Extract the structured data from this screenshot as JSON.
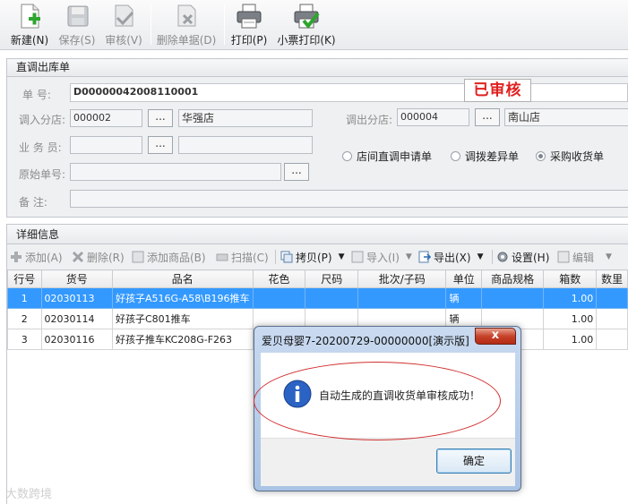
{
  "toolbar": {
    "buttons": [
      {
        "label": "新建(N)",
        "icon": "new-document-icon"
      },
      {
        "label": "保存(S)",
        "icon": "save-disk-icon"
      },
      {
        "label": "审核(V)",
        "icon": "approve-check-icon"
      },
      {
        "label": "删除单据(D)",
        "icon": "delete-document-icon"
      },
      {
        "label": "打印(P)",
        "icon": "printer-icon"
      },
      {
        "label": "小票打印(K)",
        "icon": "receipt-printer-icon"
      }
    ]
  },
  "form": {
    "panel_title": "直调出库单",
    "order_no_label": "单    号:",
    "order_no": "D00000042008110001",
    "status": "已审核",
    "in_store_label": "调入分店:",
    "in_store_code": "000002",
    "in_store_name": "华强店",
    "out_store_label": "调出分店:",
    "out_store_code": "000004",
    "out_store_name": "南山店",
    "clerk_label": "业 务 员:",
    "clerk_code": "",
    "clerk_name": "",
    "origin_label": "原始单号:",
    "origin_value": "",
    "note_label": "备    注:",
    "note_value": "",
    "ellipsis": "...",
    "radios": [
      {
        "label": "店间直调申请单",
        "checked": false
      },
      {
        "label": "调拨差异单",
        "checked": false
      },
      {
        "label": "采购收货单",
        "checked": true
      }
    ]
  },
  "detail": {
    "panel_title": "详细信息",
    "tools": [
      "添加(A)",
      "删除(R)",
      "添加商品(B)",
      "扫描(C)",
      "拷贝(P)",
      "导入(I)",
      "导出(X)",
      "设置(H)",
      "编辑"
    ],
    "columns": [
      "行号",
      "货号",
      "品名",
      "花色",
      "尺码",
      "批次/子码",
      "单位",
      "商品规格",
      "箱数",
      "数里"
    ],
    "rows": [
      [
        "1",
        "02030113",
        "好孩子A516G-A58\\B196推车",
        "",
        "",
        "",
        "辆",
        "",
        "1.00",
        ""
      ],
      [
        "2",
        "02030114",
        "好孩子C801推车",
        "",
        "",
        "",
        "辆",
        "",
        "1.00",
        ""
      ],
      [
        "3",
        "02030116",
        "好孩子推车KC208G-F263",
        "",
        "",
        "",
        "",
        "",
        "1.00",
        ""
      ]
    ]
  },
  "dialog": {
    "title": "爱贝母婴7-20200729-00000000[演示版]",
    "close": "x",
    "message": "自动生成的直调收货单审核成功！",
    "ok": "确定"
  },
  "watermark": "大数跨境",
  "colors": {
    "selected_row": "#3399ff",
    "status_red": "#e02020",
    "annotation_ellipse": "#d23030"
  }
}
